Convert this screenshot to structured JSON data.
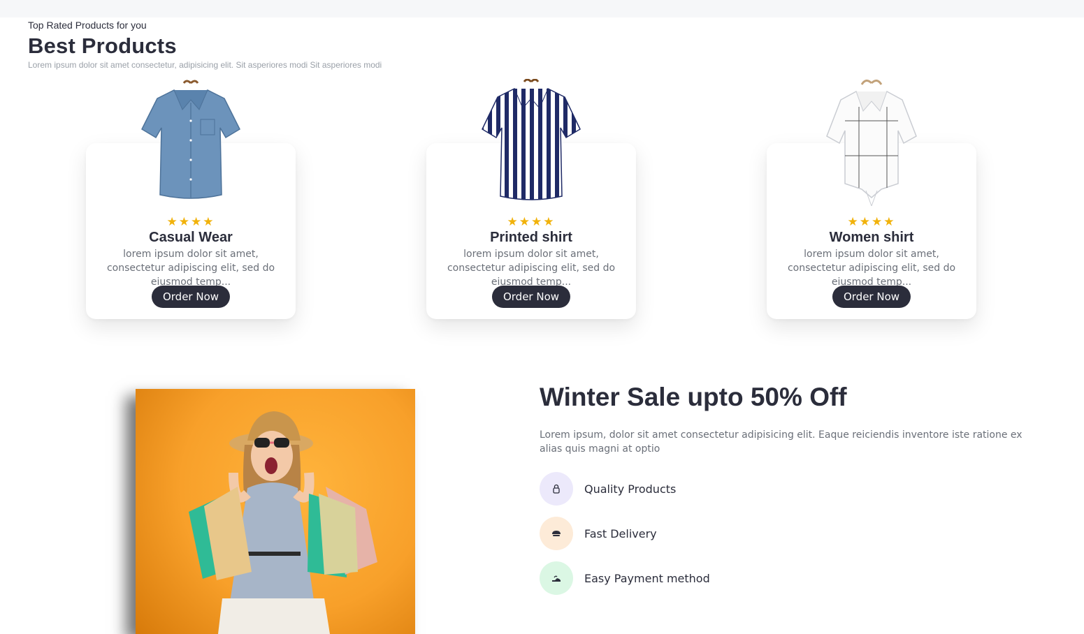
{
  "best_products": {
    "subtitle": "Top Rated Products for you",
    "title": "Best Products",
    "description": "Lorem ipsum dolor sit amet consectetur, adipisicing elit. Sit asperiores modi Sit asperiores modi"
  },
  "products": [
    {
      "stars": "★★★★",
      "name": "Casual Wear",
      "text": "lorem ipsum dolor sit amet, consectetur adipiscing elit, sed do eiusmod temp...",
      "button": "Order Now"
    },
    {
      "stars": "★★★★",
      "name": "Printed shirt",
      "text": "lorem ipsum dolor sit amet, consectetur adipiscing elit, sed do eiusmod temp...",
      "button": "Order Now"
    },
    {
      "stars": "★★★★",
      "name": "Women shirt",
      "text": "lorem ipsum dolor sit amet, consectetur adipiscing elit, sed do eiusmod temp...",
      "button": "Order Now"
    }
  ],
  "winter_sale": {
    "title": "Winter Sale upto 50% Off",
    "description": "Lorem ipsum, dolor sit amet consectetur adipisicing elit. Eaque reiciendis inventore iste ratione ex alias quis magni at optio",
    "features": [
      {
        "label": "Quality Products",
        "icon": "lock-icon",
        "color": "#ece9fb"
      },
      {
        "label": "Fast Delivery",
        "icon": "delivery-icon",
        "color": "#fdebd8"
      },
      {
        "label": "Easy Payment method",
        "icon": "payment-icon",
        "color": "#dbf7e4"
      }
    ]
  },
  "colors": {
    "primary_dark": "#2b2d3b",
    "star": "#f1b20b",
    "promo_bg": "#f8a02a"
  }
}
